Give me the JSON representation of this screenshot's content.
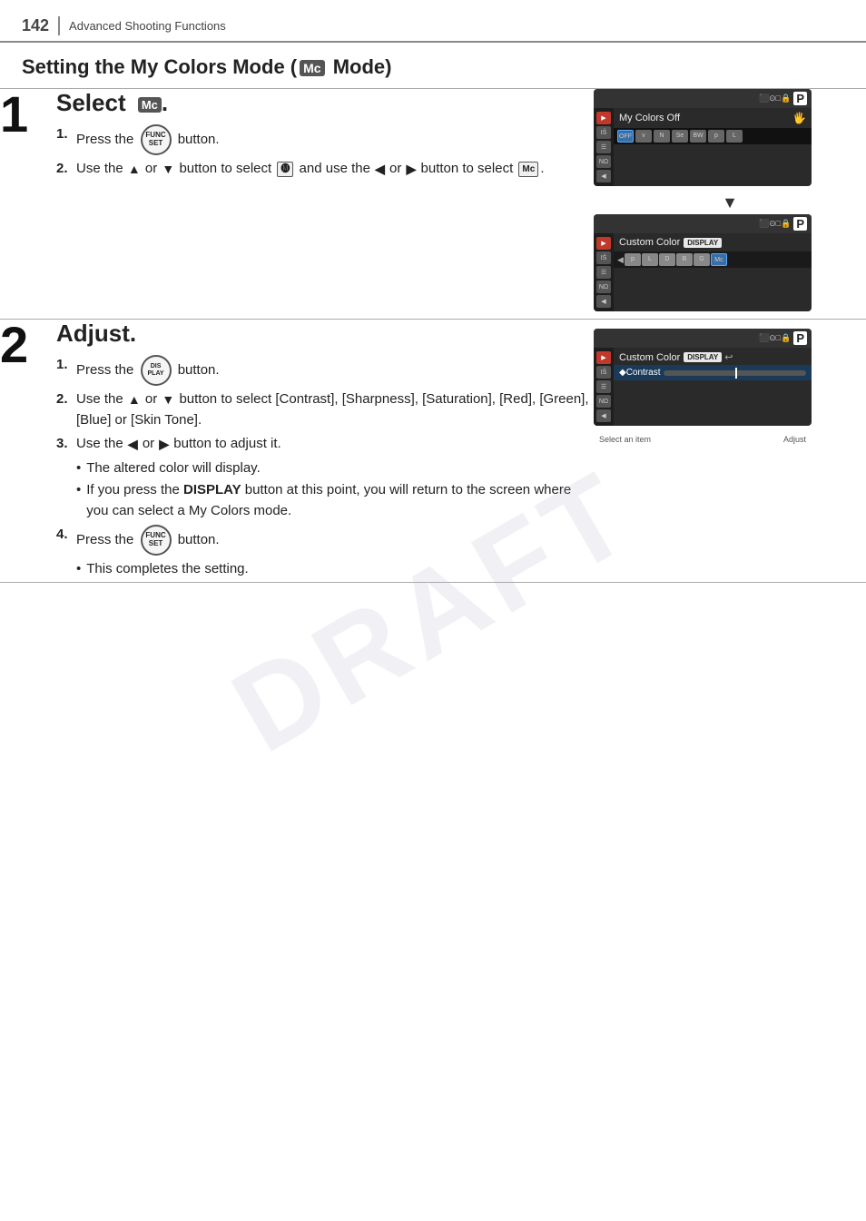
{
  "header": {
    "page_number": "142",
    "section": "Advanced Shooting Functions"
  },
  "page_title": "Setting the My Colors Mode (",
  "page_title_mode": "Mc",
  "page_title_end": " Mode)",
  "steps": [
    {
      "num": "1",
      "heading": "Select",
      "heading_icon": "Mc",
      "sub_steps": [
        {
          "num": "1.",
          "text": "Press the",
          "button": "FUNC/SET",
          "text2": "button."
        },
        {
          "num": "2.",
          "text": "Use the ▲ or ▼ button to select",
          "icon": "My Colors",
          "text2": "and use the ◀ or ▶ button to select",
          "icon2": "Mc",
          "text3": "."
        }
      ],
      "screens": [
        {
          "type": "menu",
          "menu_label": "My Colors Off",
          "strip_items": [
            "OFF",
            "v",
            "N",
            "Se",
            "BW",
            "p",
            "L"
          ]
        },
        {
          "type": "custom_color",
          "menu_label": "Custom Color",
          "display_badge": "DISPLAY",
          "strip_items": [
            "p",
            "L",
            "D",
            "B",
            "G",
            "Mc"
          ]
        }
      ]
    },
    {
      "num": "2",
      "heading": "Adjust.",
      "sub_steps": [
        {
          "num": "1.",
          "text": "Press the",
          "button": "DISPLAY",
          "text2": "button."
        },
        {
          "num": "2.",
          "text": "Use the ▲ or ▼ button to select [Contrast], [Sharpness], [Saturation], [Red], [Green], [Blue] or [Skin Tone]."
        },
        {
          "num": "3.",
          "text": "Use the ◀ or ▶ button to adjust it."
        }
      ],
      "bullet_steps": [
        "The altered color will display.",
        "If you press the DISPLAY button at this point, you will return to the screen where you can select a My Colors mode."
      ],
      "extra_steps": [
        {
          "num": "4.",
          "text": "Press the",
          "button": "FUNC/SET",
          "text2": "button."
        }
      ],
      "extra_bullets": [
        "This completes the setting."
      ],
      "screen": {
        "menu_label": "Custom Color",
        "display_badge": "DISPLAY",
        "contrast_label": "◆Contrast",
        "caption_left": "Select an item",
        "caption_right": "Adjust"
      }
    }
  ]
}
